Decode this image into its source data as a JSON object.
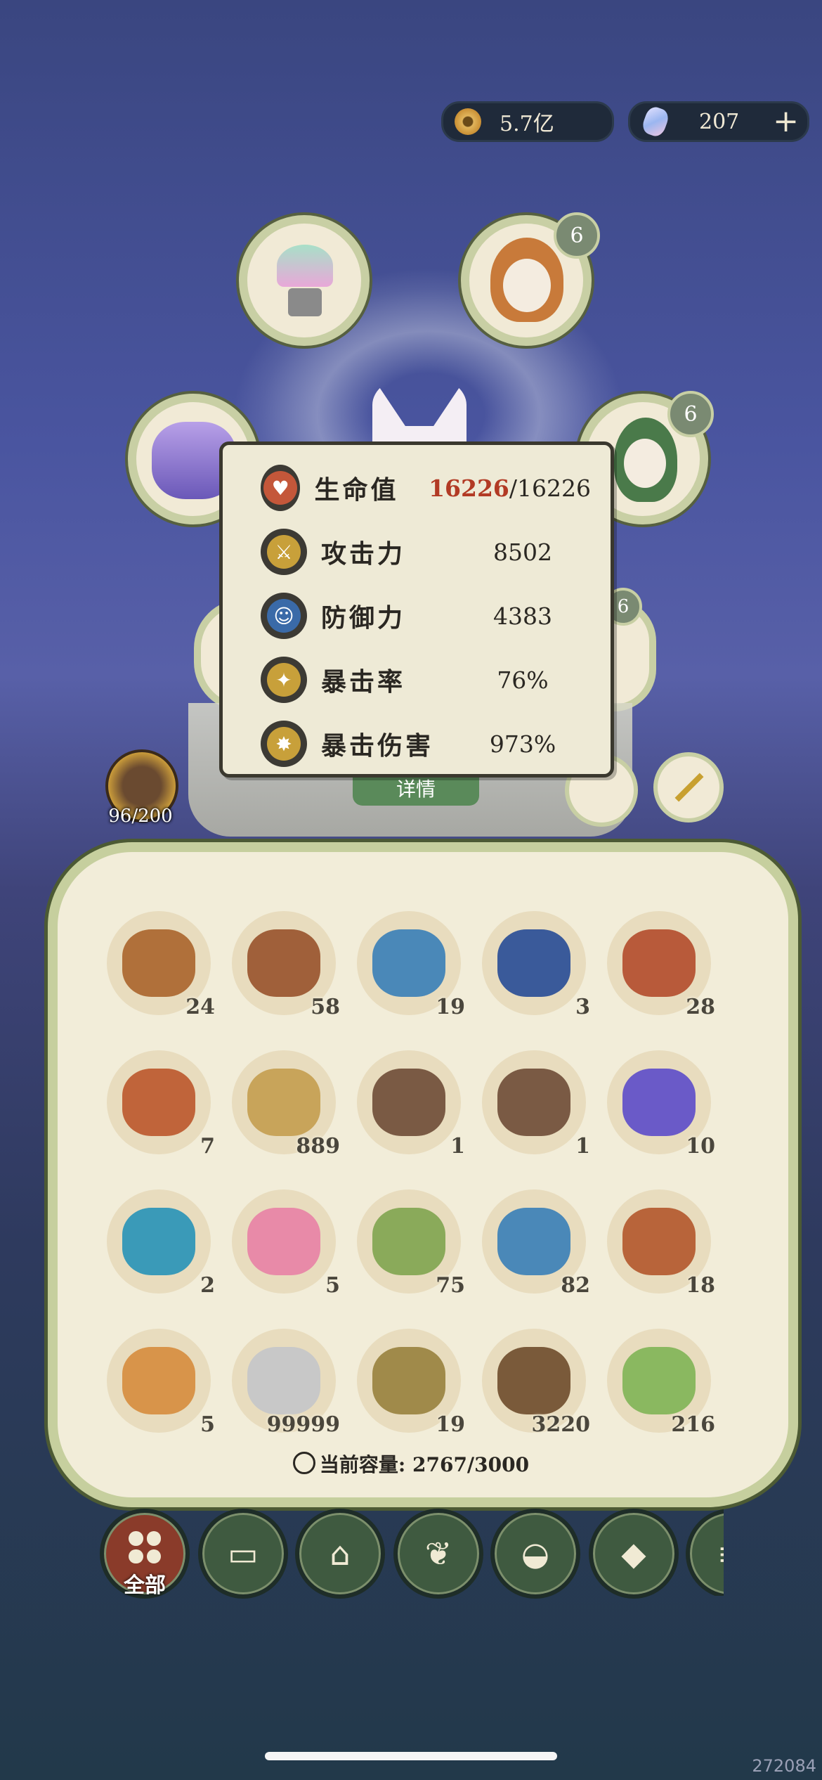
{
  "currency": {
    "coins": "5.7亿",
    "gems": "207"
  },
  "portraits": [
    {
      "id": "lotus",
      "badge": ""
    },
    {
      "id": "white-hair-girl",
      "badge": "6"
    },
    {
      "id": "purple-beast",
      "badge": ""
    },
    {
      "id": "green-hair-boy",
      "badge": "6"
    }
  ],
  "behind_button": "详情",
  "hidden_badge": "6",
  "monster_counter": "96/200",
  "stats": [
    {
      "label": "生命值",
      "value_current": "16226",
      "value_sep": "/16226",
      "color": "#c4573a"
    },
    {
      "label": "攻击力",
      "value": "8502",
      "color": "#c8a03a"
    },
    {
      "label": "防御力",
      "value": "4383",
      "color": "#3a6aa8"
    },
    {
      "label": "暴击率",
      "value": "76%",
      "color": "#c8a03a"
    },
    {
      "label": "暴击伤害",
      "value": "973%",
      "color": "#c8a03a"
    }
  ],
  "items": [
    {
      "count": "24",
      "color": "#b0703a"
    },
    {
      "count": "58",
      "color": "#a0603a"
    },
    {
      "count": "19",
      "color": "#4a88b8"
    },
    {
      "count": "3",
      "color": "#3a5a9a"
    },
    {
      "count": "28",
      "color": "#b85a3a"
    },
    {
      "count": "7",
      "color": "#c0643a"
    },
    {
      "count": "889",
      "color": "#c8a45a"
    },
    {
      "count": "1",
      "color": "#7a5a44"
    },
    {
      "count": "1",
      "color": "#7a5a44"
    },
    {
      "count": "10",
      "color": "#6a5ac8"
    },
    {
      "count": "2",
      "color": "#3a9ab8"
    },
    {
      "count": "5",
      "color": "#e88aa8"
    },
    {
      "count": "75",
      "color": "#8aaa5a"
    },
    {
      "count": "82",
      "color": "#4a88b8"
    },
    {
      "count": "18",
      "color": "#b8643a"
    },
    {
      "count": "5",
      "color": "#d8944a"
    },
    {
      "count": "99999",
      "color": "#c8c8c8"
    },
    {
      "count": "19",
      "color": "#a08a4a"
    },
    {
      "count": "3220",
      "color": "#7a5a3a"
    },
    {
      "count": "216",
      "color": "#8ab860"
    }
  ],
  "capacity": "当前容量: 2767/3000",
  "tabs": [
    {
      "id": "all",
      "label": "全部",
      "icon": "grid-icon"
    },
    {
      "id": "wood",
      "label": "",
      "icon": "log-icon"
    },
    {
      "id": "building",
      "label": "",
      "icon": "house-icon"
    },
    {
      "id": "herb",
      "label": "",
      "icon": "leaf-icon"
    },
    {
      "id": "food",
      "label": "",
      "icon": "rice-bowl-icon"
    },
    {
      "id": "material",
      "label": "",
      "icon": "crystal-icon"
    },
    {
      "id": "scroll",
      "label": "",
      "icon": "scroll-icon"
    }
  ],
  "watermark": "272084"
}
